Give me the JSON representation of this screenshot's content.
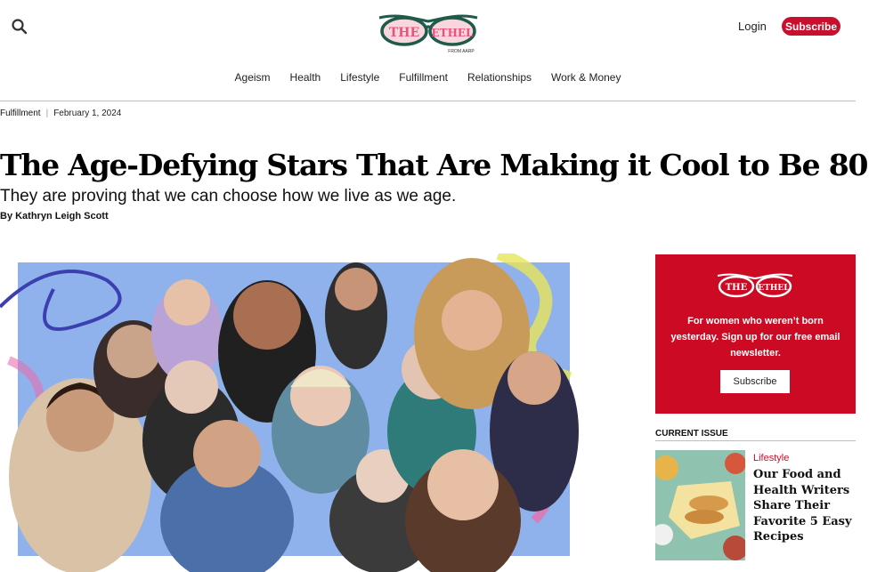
{
  "header": {
    "login_label": "Login",
    "subscribe_label": "Subscribe",
    "logo": {
      "left": "THE",
      "right": "ETHEL",
      "tagline": "FROM AARP"
    }
  },
  "nav": {
    "items": [
      "Ageism",
      "Health",
      "Lifestyle",
      "Fulfillment",
      "Relationships",
      "Work & Money"
    ]
  },
  "article": {
    "category": "Fulfillment",
    "separator": "|",
    "date": "February 1, 2024",
    "headline": "The Age-Defying Stars That Are Making it Cool to Be 80",
    "dek": "They are proving that we can choose how we live as we age.",
    "byline": "By Kathryn Leigh Scott"
  },
  "sidebar": {
    "promo": {
      "text": "For women who weren’t born yesterday. Sign up for our free email newsletter.",
      "button_label": "Subscribe"
    },
    "current_issue": {
      "label": "CURRENT ISSUE",
      "category": "Lifestyle",
      "title": "Our Food and Health Writers Share Their Favorite 5 Easy Recipes"
    }
  },
  "colors": {
    "brand_red": "#c8102e",
    "promo_red": "#cc0a23",
    "logo_green": "#1f5a4a",
    "logo_pink": "#e9527f"
  },
  "icons": {
    "search": "search-icon"
  }
}
